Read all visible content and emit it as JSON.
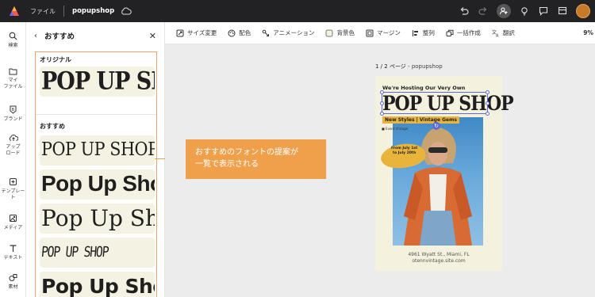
{
  "topbar": {
    "file_menu": "ファイル",
    "document_name": "popupshop"
  },
  "rail": {
    "items": [
      {
        "label": "検索",
        "icon": "search-icon"
      },
      {
        "label": "マイ\nファイル",
        "icon": "folder-icon"
      },
      {
        "label": "ブランド",
        "icon": "brand-icon"
      },
      {
        "label": "アップ\nロード",
        "icon": "upload-icon"
      },
      {
        "label": "テンプレー\nト",
        "icon": "template-icon"
      },
      {
        "label": "メディア",
        "icon": "media-icon"
      },
      {
        "label": "テキスト",
        "icon": "text-icon"
      },
      {
        "label": "素材",
        "icon": "elements-icon"
      }
    ]
  },
  "panel": {
    "title": "おすすめ",
    "original_label": "オリジナル",
    "recommended_label": "おすすめ",
    "sample_text": "POP UP SHOP",
    "fonts": [
      "POP UP SHOP",
      "Pop Up Shop",
      "Pop Up Shop",
      "POP UP SHOP",
      "Pop Up Shop"
    ]
  },
  "toolbar": {
    "items": [
      "サイズ変更",
      "配色",
      "アニメーション",
      "背景色",
      "マージン",
      "整列",
      "一括作成",
      "翻訳"
    ],
    "zoom": "9%"
  },
  "canvas": {
    "page_indicator": "1 / 2 ページ",
    "page_name": "popupshop"
  },
  "poster": {
    "hosting": "We're Hosting Our Very Own",
    "headline": "POP UP SHOP",
    "tag": "New Styles | Vintage Gems",
    "small": "■ Event Vintage",
    "dates": "From July 1st\nto July 20th",
    "address": "4961 Wyatt St., Miami, FL",
    "website": "otennvintage.site.com"
  },
  "callout": {
    "text": "おすすめのフォントの提案が\n一覧で表示される"
  },
  "colors": {
    "accent": "#f0a04b",
    "selection": "#5b6bd6",
    "topbar_bg": "#222224"
  }
}
